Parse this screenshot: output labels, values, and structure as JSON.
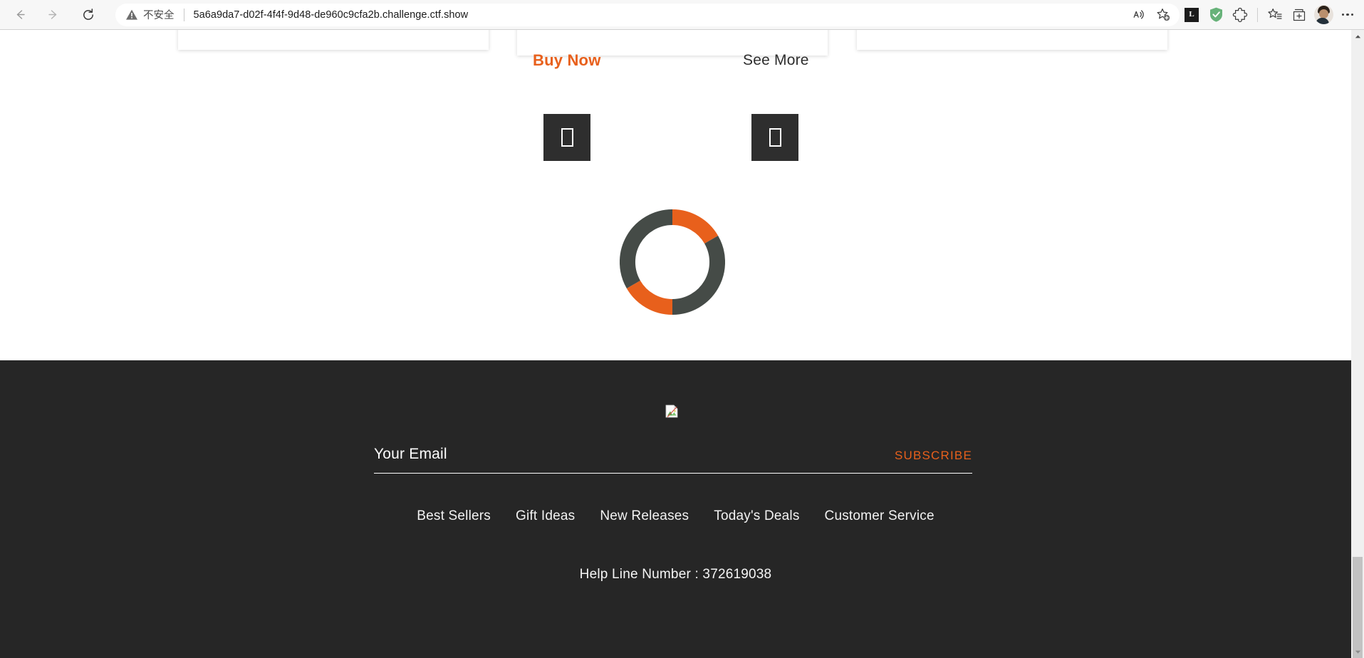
{
  "browser": {
    "back_label": "Back",
    "forward_label": "Forward",
    "reload_label": "Refresh",
    "security_text": "不安全",
    "url": "5a6a9da7-d02f-4f4f-9d48-de960c9cfa2b.challenge.ctf.show",
    "read_aloud_label": "Read aloud",
    "add_favorite_label": "Add this page to favorites",
    "extension_l_label": "L",
    "shield_label": "AdGuard",
    "extensions_label": "Extensions",
    "favorites_label": "Favorites",
    "collections_label": "Collections",
    "profile_label": "Profile",
    "settings_label": "Settings and more"
  },
  "page": {
    "cards": {
      "buy_now_label": "Buy Now",
      "see_more_label": "See More"
    },
    "spinner": {
      "orange": "#e8601c",
      "dark": "#454b47"
    },
    "footer": {
      "email_placeholder": "Your Email",
      "email_value": "",
      "subscribe_label": "SUBSCRIBE",
      "links": [
        "Best Sellers",
        "Gift Ideas",
        "New Releases",
        "Today's Deals",
        "Customer Service"
      ],
      "help_line": "Help Line Number : 372619038",
      "background": "#262626"
    }
  }
}
